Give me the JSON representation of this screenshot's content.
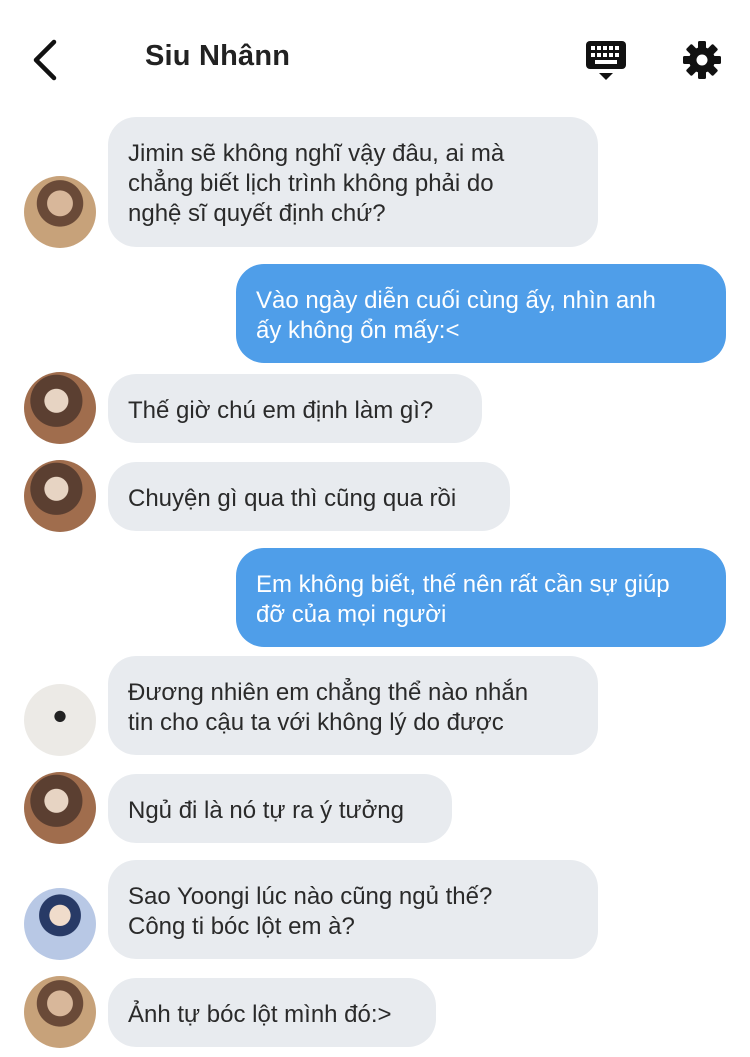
{
  "header": {
    "title": "Siu Nhânn",
    "icons": {
      "back": "chevron-left-icon",
      "keyboard": "keyboard-icon",
      "settings": "gear-icon"
    }
  },
  "messages": [
    {
      "side": "in",
      "text": "Jimin sẽ không nghĩ vậy đâu, ai mà\nchẳng biết lịch trình không phải do\nnghệ sĩ quyết định chứ?"
    },
    {
      "side": "out",
      "text": "Vào ngày diễn cuối cùng ấy, nhìn anh\nấy không ổn mấy:<"
    },
    {
      "side": "in",
      "text": "Thế giờ chú em định làm gì?"
    },
    {
      "side": "in",
      "text": "Chuyện gì qua thì cũng qua rồi"
    },
    {
      "side": "out",
      "text": "Em không biết, thế nên rất cần sự giúp\nđỡ của mọi người"
    },
    {
      "side": "in",
      "text": "Đương nhiên em chẳng thể nào nhắn\ntin cho cậu ta với không lý do được"
    },
    {
      "side": "in",
      "text": "Ngủ đi là nó tự ra ý tưởng"
    },
    {
      "side": "in",
      "text": "Sao Yoongi lúc nào cũng ngủ thế?\nCông ti bóc lột em à?"
    },
    {
      "side": "in",
      "text": "Ảnh tự bóc lột mình đó:>"
    }
  ],
  "colors": {
    "incoming_bubble": "#e8ebef",
    "outgoing_bubble": "#4f9ee9"
  }
}
